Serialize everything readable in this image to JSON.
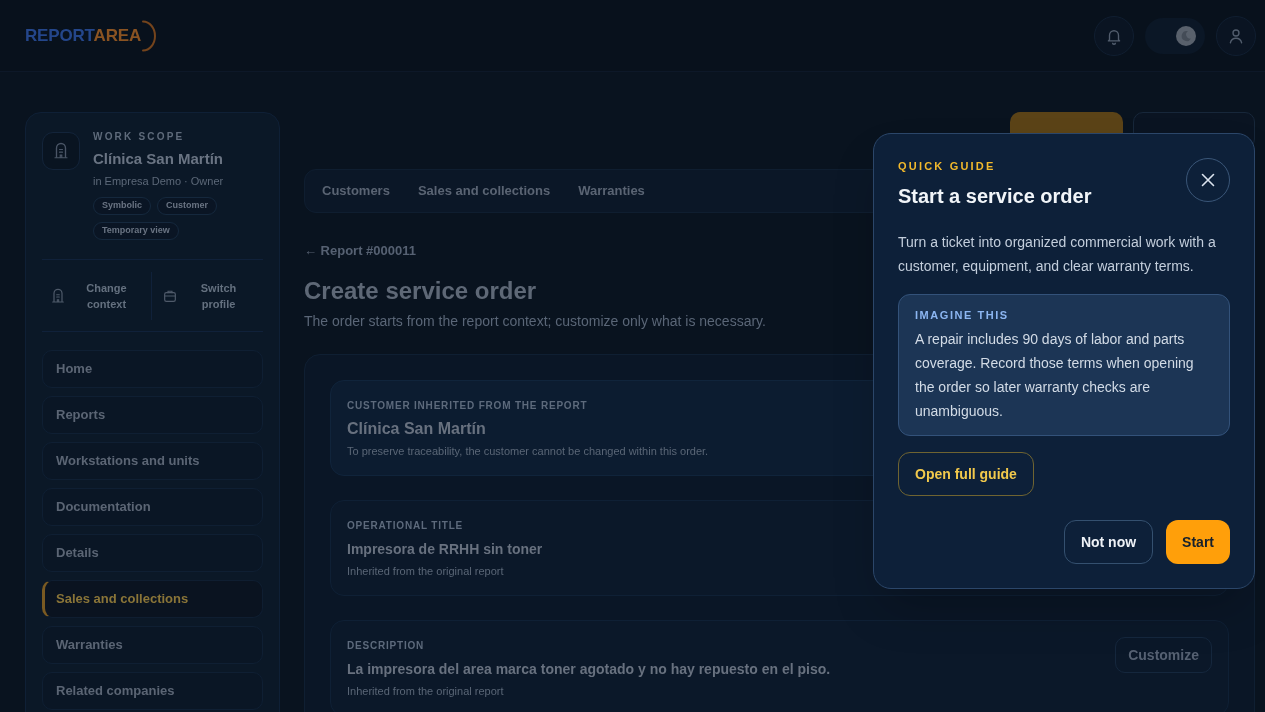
{
  "header": {
    "logo": {
      "part_1": "REPORT",
      "part_2": "AREA"
    },
    "theme_toggle": {
      "on": true
    }
  },
  "sidebar": {
    "scope": {
      "label": "WORK SCOPE",
      "name": "Clínica San Martín",
      "meta": "in Empresa Demo · Owner",
      "chips": [
        "Symbolic",
        "Customer",
        "Temporary view"
      ]
    },
    "actions": [
      {
        "label": "Change context",
        "kind": "context"
      },
      {
        "label": "Switch profile",
        "kind": "profile"
      }
    ],
    "nav": [
      {
        "label": "Home",
        "selected": false
      },
      {
        "label": "Reports",
        "selected": false
      },
      {
        "label": "Workstations and units",
        "selected": false
      },
      {
        "label": "Documentation",
        "selected": false
      },
      {
        "label": "Details",
        "selected": false
      },
      {
        "label": "Sales and collections",
        "selected": true
      },
      {
        "label": "Warranties",
        "selected": false
      },
      {
        "label": "Related companies",
        "selected": false
      }
    ]
  },
  "main": {
    "page_actions": [
      {
        "kind": "primary"
      },
      {
        "kind": "secondary"
      }
    ],
    "tabs": [
      {
        "label": "Customers"
      },
      {
        "label": "Sales and collections"
      },
      {
        "label": "Warranties"
      }
    ],
    "back_link": "← Report #000011",
    "title": "Create service order",
    "subtitle": "The order starts from the report context; customize only what is necessary.",
    "fields": [
      {
        "kind": "locked",
        "label": "CUSTOMER INHERITED FROM THE REPORT",
        "value": "Clínica San Martín",
        "note": "To preserve traceability, the customer cannot be changed within this order."
      },
      {
        "kind": "editable",
        "label": "OPERATIONAL TITLE",
        "value": "Impresora de RRHH sin toner",
        "note": "Inherited from the original report"
      },
      {
        "kind": "editable",
        "label": "DESCRIPTION",
        "value": "La impresora del area marca toner agotado y no hay repuesto en el piso.",
        "note": "Inherited from the original report",
        "action": "Customize"
      }
    ]
  },
  "guide": {
    "eyebrow": "QUICK GUIDE",
    "title": "Start a service order",
    "body": "Turn a ticket into organized commercial work with a customer, equipment, and clear warranty terms.",
    "callout": {
      "label": "IMAGINE THIS",
      "text": "A repair includes 90 days of labor and parts coverage. Record those terms when opening the order so later warranty checks are unambiguous."
    },
    "link_button": "Open full guide",
    "buttons": [
      {
        "label": "Not now",
        "kind": "secondary"
      },
      {
        "label": "Start",
        "kind": "primary"
      }
    ]
  }
}
